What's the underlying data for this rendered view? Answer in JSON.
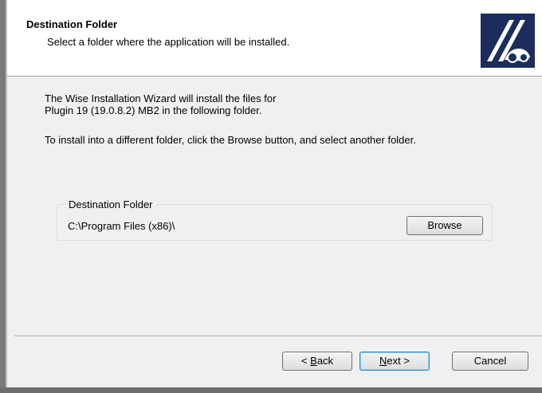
{
  "header": {
    "title": "Destination Folder",
    "subtitle": "Select a folder where the application will be installed."
  },
  "body": {
    "line1": "The Wise Installation Wizard will install the files for",
    "line2": "Plugin 19 (19.0.8.2) MB2 in the following folder.",
    "line3": "To install into a different folder, click the Browse button, and select another folder."
  },
  "destination": {
    "group_label": "Destination Folder",
    "path": "C:\\Program Files (x86)\\",
    "browse_label": "Browse"
  },
  "buttons": {
    "back_prefix": "< ",
    "back_mnemonic": "B",
    "back_rest": "ack",
    "next_mnemonic": "N",
    "next_rest": "ext >",
    "cancel_label": "Cancel"
  },
  "icons": {
    "logo": "wise-installer-logo-icon"
  },
  "colors": {
    "logo_bg": "#1c2d5d",
    "dialog_bg": "#f0f0f0",
    "default_button_border": "#3c7fb1"
  }
}
